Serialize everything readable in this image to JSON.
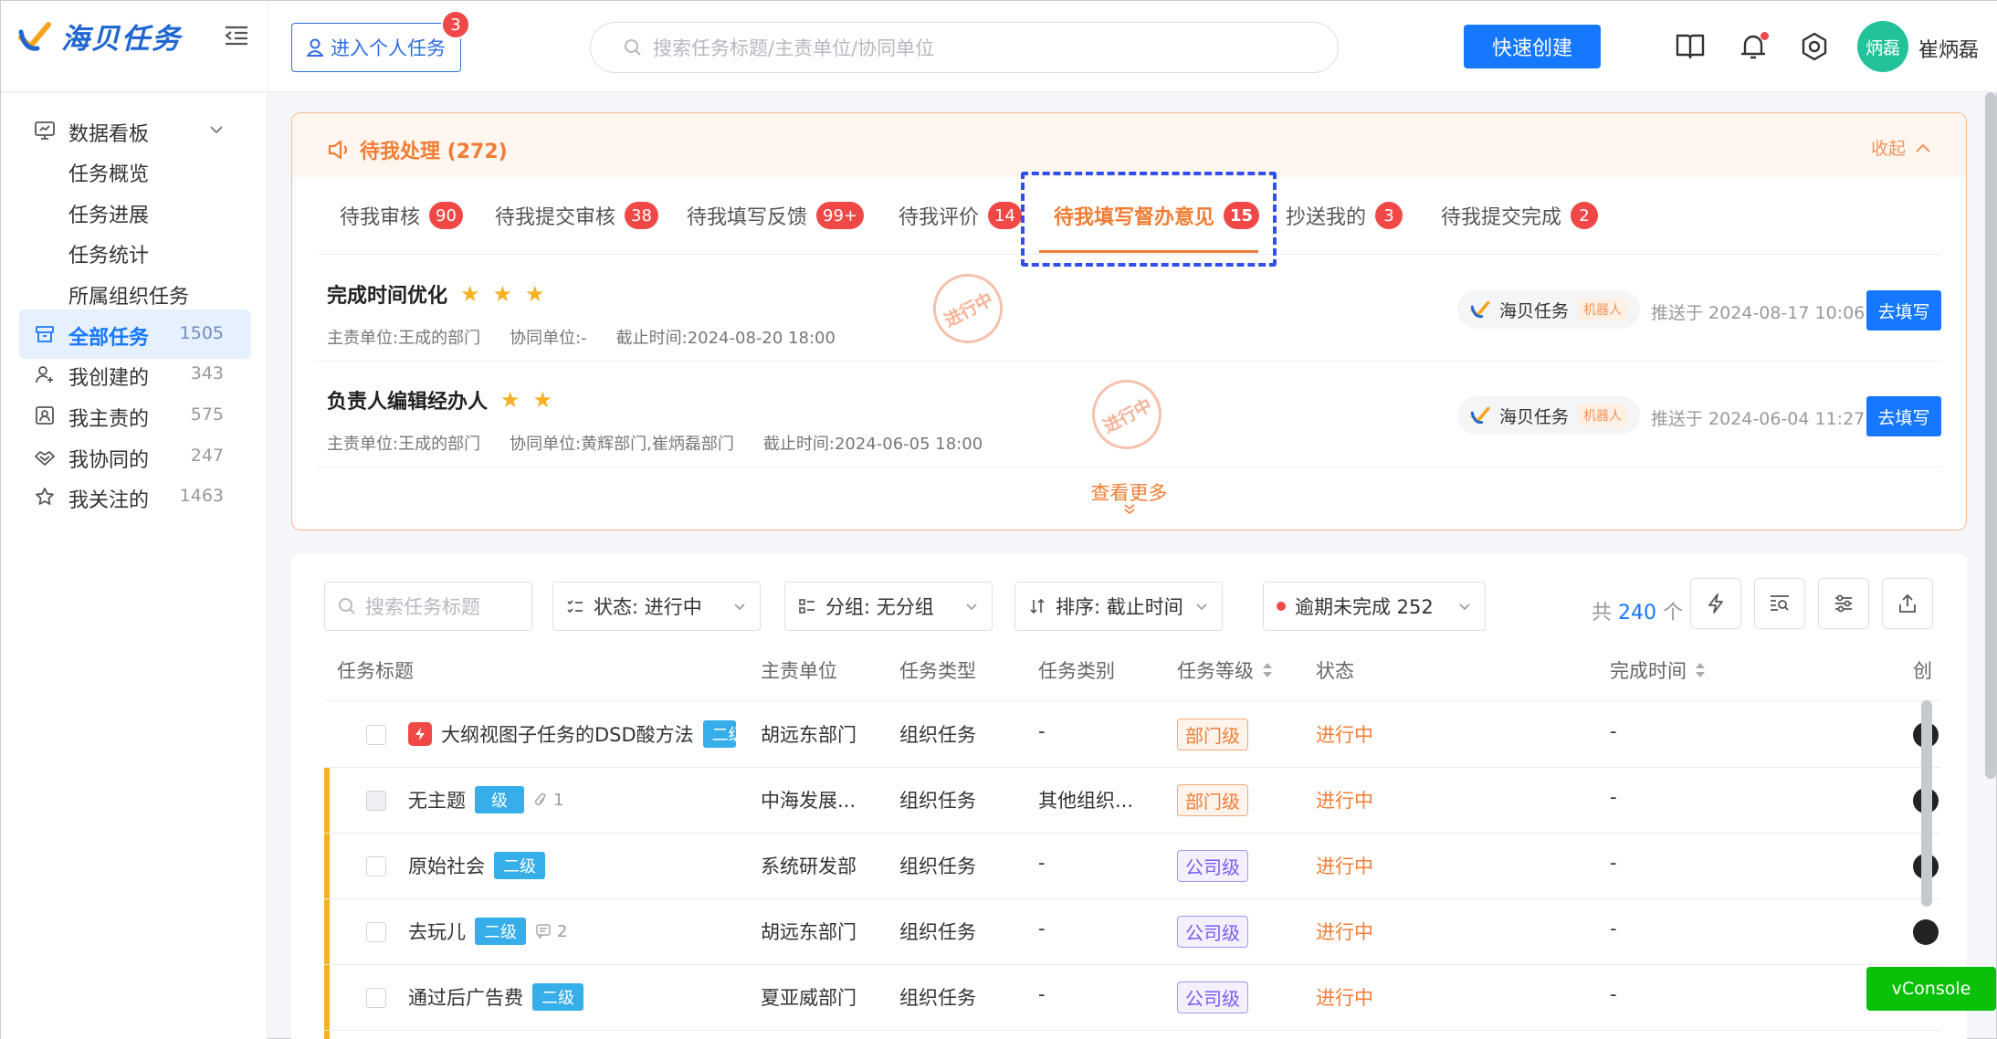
{
  "app": {
    "name": "海贝任务"
  },
  "header": {
    "personal_button": "进入个人任务",
    "personal_badge": "3",
    "search_placeholder": "搜索任务标题/主责单位/协同单位",
    "quick_create": "快速创建",
    "avatar_text": "炳磊",
    "username": "崔炳磊",
    "icons": [
      "book-icon",
      "bell-icon",
      "settings-icon"
    ]
  },
  "sidebar": {
    "dashboard": {
      "label": "数据看板",
      "children": [
        "任务概览",
        "任务进展",
        "任务统计",
        "所属组织任务"
      ]
    },
    "items": [
      {
        "label": "全部任务",
        "count": "1505",
        "icon": "archive-icon",
        "active": true
      },
      {
        "label": "我创建的",
        "count": "343",
        "icon": "user-add-icon"
      },
      {
        "label": "我主责的",
        "count": "575",
        "icon": "id-card-icon"
      },
      {
        "label": "我协同的",
        "count": "247",
        "icon": "handshake-icon"
      },
      {
        "label": "我关注的",
        "count": "1463",
        "icon": "star-outline-icon"
      }
    ]
  },
  "pending": {
    "title": "待我处理 (272)",
    "collapse": "收起",
    "tabs": [
      {
        "label": "待我审核",
        "badge": "90"
      },
      {
        "label": "待我提交审核",
        "badge": "38"
      },
      {
        "label": "待我填写反馈",
        "badge": "99+"
      },
      {
        "label": "待我评价",
        "badge": "14"
      },
      {
        "label": "待我填写督办意见",
        "badge": "15",
        "active": true
      },
      {
        "label": "抄送我的",
        "badge": "3"
      },
      {
        "label": "待我提交完成",
        "badge": "2"
      }
    ],
    "rows": [
      {
        "title": "完成时间优化",
        "stars": 3,
        "main_unit": "主责单位:王成的部门",
        "coop_unit": "协同单位:-",
        "deadline": "截止时间:2024-08-20 18:00",
        "stamp": "进行中",
        "bot_name": "海贝任务",
        "bot_tag": "机器人",
        "pushed": "推送于 2024-08-17 10:06",
        "action": "去填写"
      },
      {
        "title": "负责人编辑经办人",
        "stars": 2,
        "main_unit": "主责单位:王成的部门",
        "coop_unit": "协同单位:黄辉部门,崔炳磊部门",
        "deadline": "截止时间:2024-06-05 18:00",
        "stamp": "进行中",
        "bot_name": "海贝任务",
        "bot_tag": "机器人",
        "pushed": "推送于 2024-06-04 11:27",
        "action": "去填写"
      }
    ],
    "more": "查看更多"
  },
  "table": {
    "filters": {
      "search_placeholder": "搜索任务标题",
      "status": "状态: 进行中",
      "group": "分组: 无分组",
      "sort": "排序: 截止时间",
      "overdue": "逾期未完成 252",
      "total_prefix": "共",
      "total": "240",
      "total_suffix": "个"
    },
    "columns": [
      "任务标题",
      "主责单位",
      "任务类型",
      "任务类别",
      "任务等级",
      "状态",
      "完成时间",
      "创"
    ],
    "rows": [
      {
        "title": "大纲视图子任务的DSD酸方法",
        "level": "二级",
        "urgent": true,
        "unit": "胡远东部门",
        "type": "组织任务",
        "category": "-",
        "grade": "部门级",
        "grade_color": "orange",
        "status": "进行中",
        "done": "-",
        "flag": false
      },
      {
        "title": "无主题",
        "level": "级",
        "attach": "1",
        "unit": "中海发展...",
        "type": "组织任务",
        "category": "其他组织...",
        "grade": "部门级",
        "grade_color": "orange",
        "status": "进行中",
        "done": "-",
        "flag": true
      },
      {
        "title": "原始社会",
        "level": "二级",
        "unit": "系统研发部",
        "type": "组织任务",
        "category": "-",
        "grade": "公司级",
        "grade_color": "purple",
        "status": "进行中",
        "done": "-",
        "flag": true
      },
      {
        "title": "去玩儿",
        "level": "二级",
        "comments": "2",
        "unit": "胡远东部门",
        "type": "组织任务",
        "category": "-",
        "grade": "公司级",
        "grade_color": "purple",
        "status": "进行中",
        "done": "-",
        "flag": true
      },
      {
        "title": "通过后广告费",
        "level": "二级",
        "unit": "夏亚威部门",
        "type": "组织任务",
        "category": "-",
        "grade": "公司级",
        "grade_color": "purple",
        "status": "进行中",
        "done": "-",
        "flag": true
      }
    ]
  },
  "vconsole": "vConsole",
  "colors": {
    "primary": "#1677ff",
    "accent_orange": "#f07d35",
    "badge_red": "#f04747",
    "purple": "#7b5cf0",
    "level_blue": "#35aeea",
    "flag_yellow": "#f7b023",
    "vconsole_green": "#08c108"
  }
}
